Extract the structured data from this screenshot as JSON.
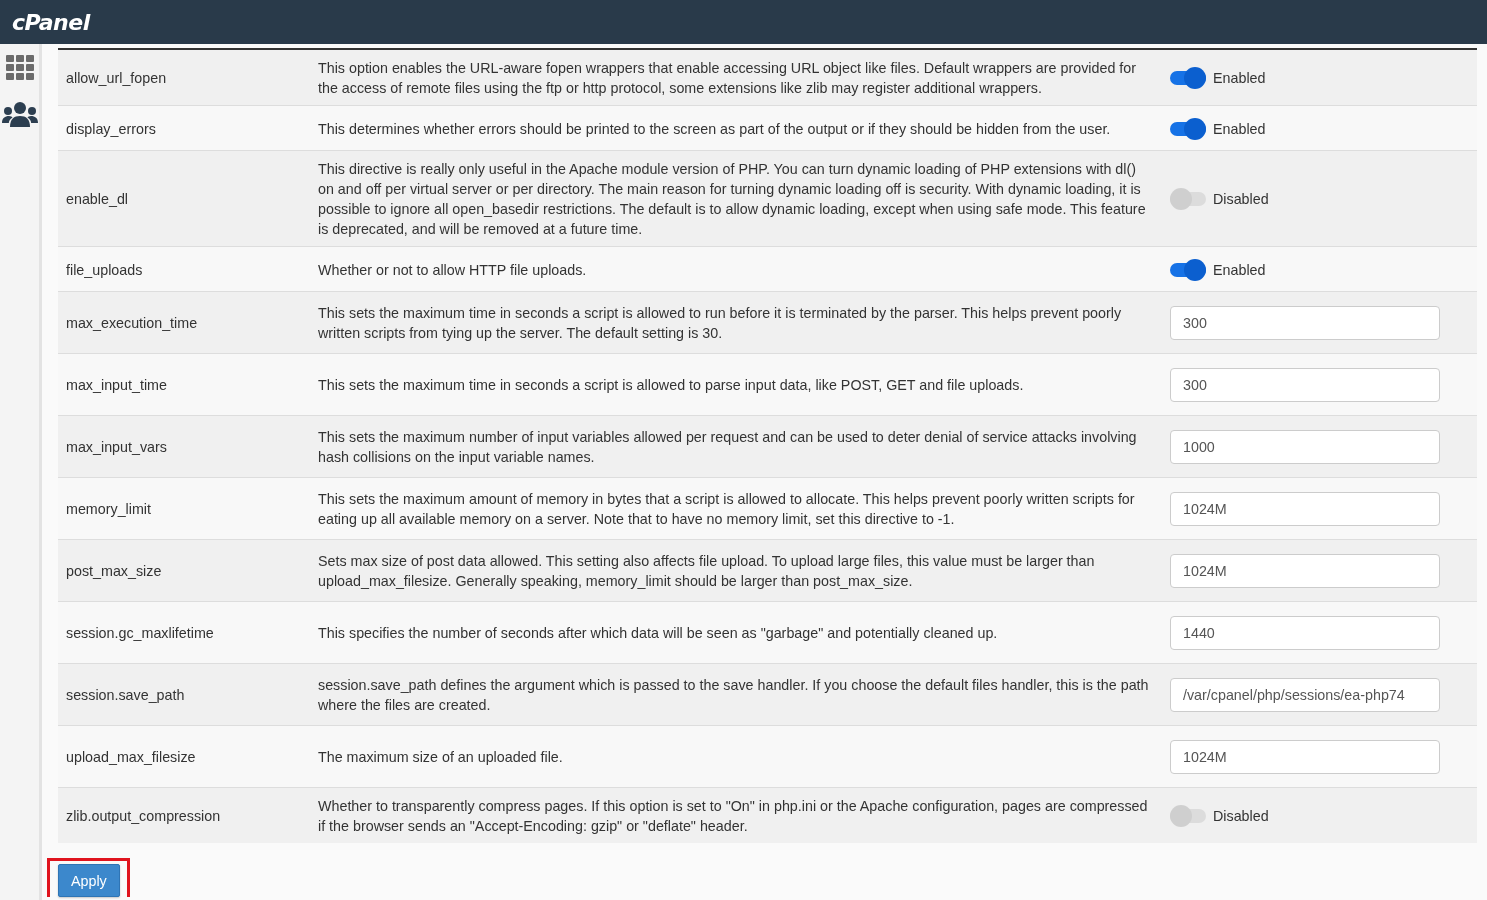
{
  "header": {
    "logo": "cPanel"
  },
  "rows": [
    {
      "name": "allow_url_fopen",
      "description": "This option enables the URL-aware fopen wrappers that enable accessing URL object like files. Default wrappers are provided for the access of remote files using the ftp or http protocol, some extensions like zlib may register additional wrappers.",
      "kind": "toggle",
      "on": true,
      "state_label": "Enabled"
    },
    {
      "name": "display_errors",
      "description": "This determines whether errors should be printed to the screen as part of the output or if they should be hidden from the user.",
      "kind": "toggle",
      "on": true,
      "state_label": "Enabled"
    },
    {
      "name": "enable_dl",
      "description": "This directive is really only useful in the Apache module version of PHP. You can turn dynamic loading of PHP extensions with dl() on and off per virtual server or per directory. The main reason for turning dynamic loading off is security. With dynamic loading, it is possible to ignore all open_basedir restrictions. The default is to allow dynamic loading, except when using safe mode. This feature is deprecated, and will be removed at a future time.",
      "kind": "toggle",
      "on": false,
      "state_label": "Disabled"
    },
    {
      "name": "file_uploads",
      "description": "Whether or not to allow HTTP file uploads.",
      "kind": "toggle",
      "on": true,
      "state_label": "Enabled"
    },
    {
      "name": "max_execution_time",
      "description": "This sets the maximum time in seconds a script is allowed to run before it is terminated by the parser. This helps prevent poorly written scripts from tying up the server. The default setting is 30.",
      "kind": "input",
      "value": "300"
    },
    {
      "name": "max_input_time",
      "description": "This sets the maximum time in seconds a script is allowed to parse input data, like POST, GET and file uploads.",
      "kind": "input",
      "value": "300"
    },
    {
      "name": "max_input_vars",
      "description": "This sets the maximum number of input variables allowed per request and can be used to deter denial of service attacks involving hash collisions on the input variable names.",
      "kind": "input",
      "value": "1000"
    },
    {
      "name": "memory_limit",
      "description": "This sets the maximum amount of memory in bytes that a script is allowed to allocate. This helps prevent poorly written scripts for eating up all available memory on a server. Note that to have no memory limit, set this directive to -1.",
      "kind": "input",
      "value": "1024M"
    },
    {
      "name": "post_max_size",
      "description": "Sets max size of post data allowed. This setting also affects file upload. To upload large files, this value must be larger than upload_max_filesize. Generally speaking, memory_limit should be larger than post_max_size.",
      "kind": "input",
      "value": "1024M"
    },
    {
      "name": "session.gc_maxlifetime",
      "description": "This specifies the number of seconds after which data will be seen as \"garbage\" and potentially cleaned up.",
      "kind": "input",
      "value": "1440"
    },
    {
      "name": "session.save_path",
      "description": "session.save_path defines the argument which is passed to the save handler. If you choose the default files handler, this is the path where the files are created.",
      "kind": "input",
      "value": "/var/cpanel/php/sessions/ea-php74"
    },
    {
      "name": "upload_max_filesize",
      "description": "The maximum size of an uploaded file.",
      "kind": "input",
      "value": "1024M"
    },
    {
      "name": "zlib.output_compression",
      "description": "Whether to transparently compress pages. If this option is set to \"On\" in php.ini or the Apache configuration, pages are compressed if the browser sends an \"Accept-Encoding: gzip\" or \"deflate\" header.",
      "kind": "toggle",
      "on": false,
      "state_label": "Disabled"
    }
  ],
  "apply": {
    "label": "Apply",
    "highlighted": true
  }
}
